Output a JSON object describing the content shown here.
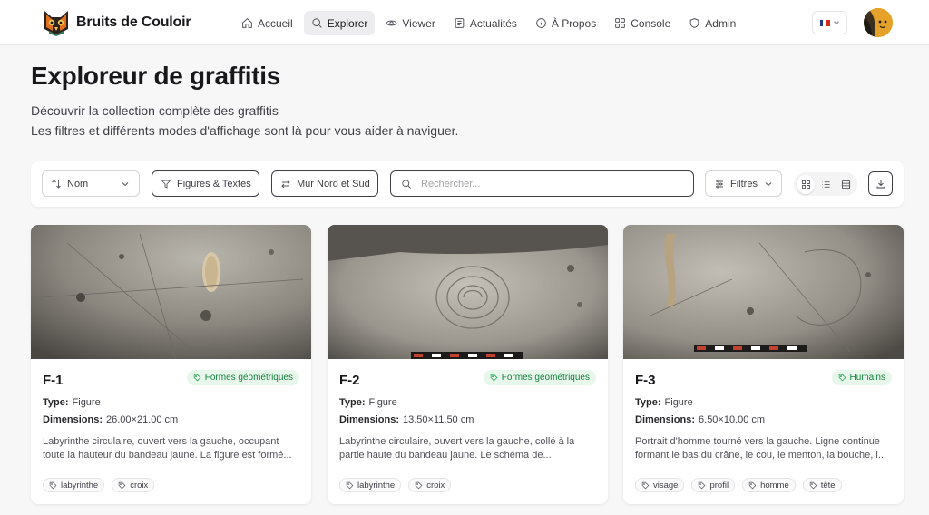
{
  "app": {
    "name": "Bruits de Couloir",
    "nav": [
      {
        "label": "Accueil",
        "icon": "home-icon"
      },
      {
        "label": "Explorer",
        "icon": "search-icon",
        "active": true
      },
      {
        "label": "Viewer",
        "icon": "eye-icon"
      },
      {
        "label": "Actualités",
        "icon": "newspaper-icon"
      },
      {
        "label": "À Propos",
        "icon": "info-icon"
      },
      {
        "label": "Console",
        "icon": "dashboard-icon"
      },
      {
        "label": "Admin",
        "icon": "shield-icon"
      }
    ],
    "language_flag": [
      "#1f3c8f",
      "#ffffff",
      "#d52b1e"
    ]
  },
  "page": {
    "title": "Exploreur de graffitis",
    "subtitle_line1": "Découvrir la collection complète des graffitis",
    "subtitle_line2": "Les filtres et différents modes d'affichage sont là pour vous aider à naviguer."
  },
  "toolbar": {
    "sort_label": "Nom",
    "type_filter_label": "Figures & Textes",
    "wall_filter_label": "Mur Nord et Sud",
    "search_placeholder": "Rechercher...",
    "filters_label": "Filtres",
    "view_mode": "grid"
  },
  "cards": [
    {
      "id": "F-1",
      "category": "Formes géométriques",
      "type_label": "Type:",
      "type": "Figure",
      "dim_label": "Dimensions:",
      "dimensions": "26.00×21.00 cm",
      "description": "Labyrinthe circulaire, ouvert vers la gauche, occupant toute la hauteur du bandeau jaune. La figure est formé...",
      "tags": [
        "labyrinthe",
        "croix"
      ]
    },
    {
      "id": "F-2",
      "category": "Formes géométriques",
      "type_label": "Type:",
      "type": "Figure",
      "dim_label": "Dimensions:",
      "dimensions": "13.50×11.50 cm",
      "description": "Labyrinthe circulaire, ouvert vers la gauche, collé à la partie haute du bandeau jaune. Le schéma de...",
      "tags": [
        "labyrinthe",
        "croix"
      ]
    },
    {
      "id": "F-3",
      "category": "Humains",
      "type_label": "Type:",
      "type": "Figure",
      "dim_label": "Dimensions:",
      "dimensions": "6.50×10.00 cm",
      "description": "Portrait d'homme tourné vers la gauche. Ligne continue formant le bas du crâne, le cou, le menton, la bouche, l...",
      "tags": [
        "visage",
        "profil",
        "homme",
        "tête"
      ]
    }
  ]
}
